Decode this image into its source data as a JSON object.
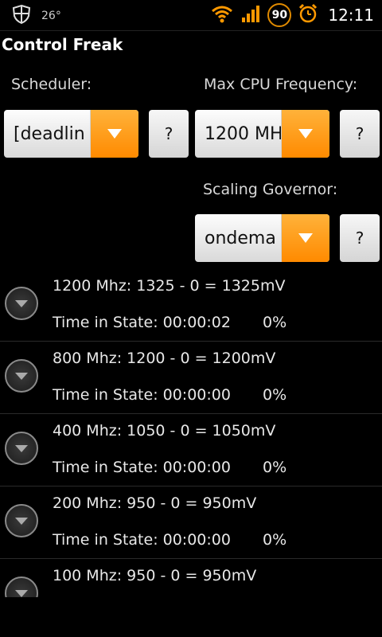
{
  "status_bar": {
    "temperature": "26°",
    "battery": "90",
    "time": "12:11"
  },
  "app": {
    "title": "Control Freak"
  },
  "scheduler": {
    "label": "Scheduler:",
    "value": "[deadlin",
    "help": "?"
  },
  "max_cpu": {
    "label": "Max CPU Frequency:",
    "value": "1200 MH",
    "help": "?"
  },
  "governor": {
    "label": "Scaling Governor:",
    "value": "ondema",
    "help": "?"
  },
  "states": [
    {
      "main": "1200 Mhz: 1325 - 0 = 1325mV",
      "time": "Time in State: 00:00:02",
      "pct": "0%"
    },
    {
      "main": "800 Mhz: 1200 - 0 = 1200mV",
      "time": "Time in State: 00:00:00",
      "pct": "0%"
    },
    {
      "main": "400 Mhz: 1050 - 0 = 1050mV",
      "time": "Time in State: 00:00:00",
      "pct": "0%"
    },
    {
      "main": "200 Mhz: 950 - 0 = 950mV",
      "time": "Time in State: 00:00:00",
      "pct": "0%"
    },
    {
      "main": "100 Mhz: 950 - 0 = 950mV",
      "time": "",
      "pct": ""
    }
  ]
}
